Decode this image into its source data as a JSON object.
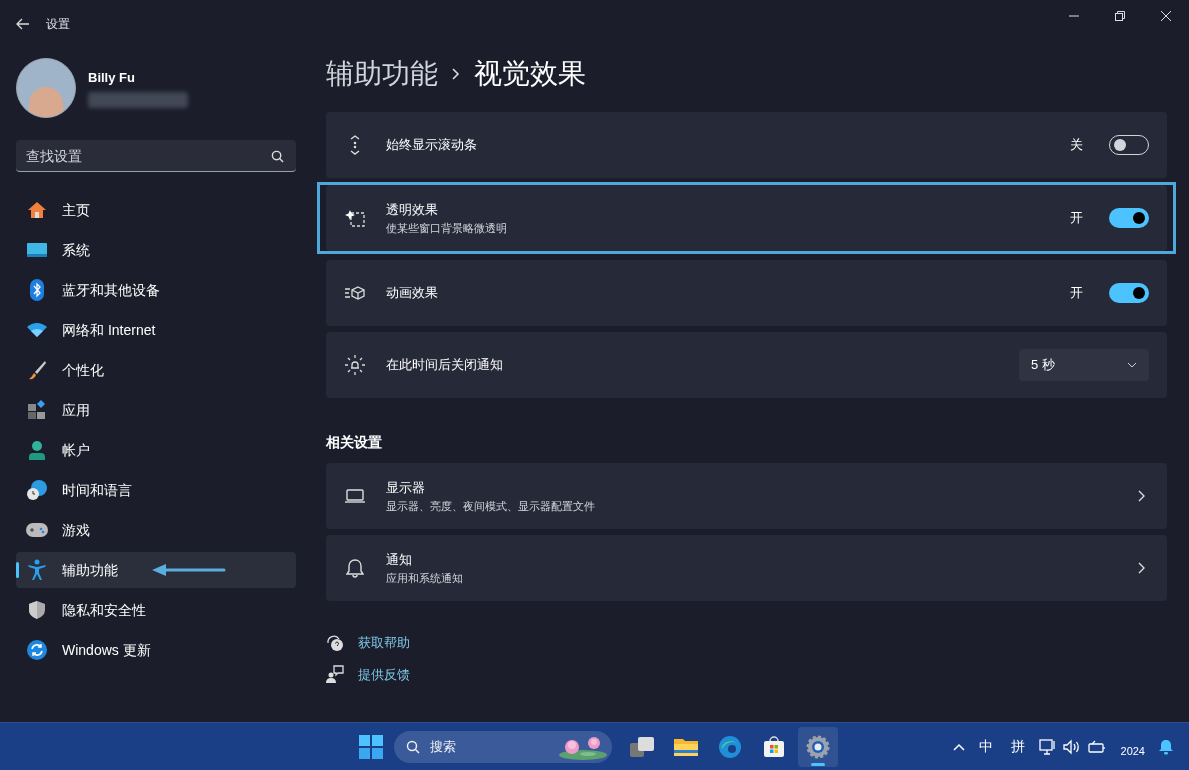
{
  "window": {
    "title": "设置"
  },
  "user": {
    "name": "Billy Fu"
  },
  "search": {
    "placeholder": "查找设置"
  },
  "sidebar": {
    "items": [
      {
        "label": "主页",
        "selected": false,
        "pointer_arrow": false
      },
      {
        "label": "系统",
        "selected": false,
        "pointer_arrow": false
      },
      {
        "label": "蓝牙和其他设备",
        "selected": false,
        "pointer_arrow": false
      },
      {
        "label": "网络和 Internet",
        "selected": false,
        "pointer_arrow": false
      },
      {
        "label": "个性化",
        "selected": false,
        "pointer_arrow": false
      },
      {
        "label": "应用",
        "selected": false,
        "pointer_arrow": false
      },
      {
        "label": "帐户",
        "selected": false,
        "pointer_arrow": false
      },
      {
        "label": "时间和语言",
        "selected": false,
        "pointer_arrow": false
      },
      {
        "label": "游戏",
        "selected": false,
        "pointer_arrow": false
      },
      {
        "label": "辅助功能",
        "selected": true,
        "pointer_arrow": true
      },
      {
        "label": "隐私和安全性",
        "selected": false,
        "pointer_arrow": false
      },
      {
        "label": "Windows 更新",
        "selected": false,
        "pointer_arrow": false
      }
    ]
  },
  "breadcrumb": [
    "辅助功能",
    "视觉效果"
  ],
  "settings": [
    {
      "kind": "toggle",
      "label": "始终显示滚动条",
      "state_text": "关",
      "on": false,
      "highlighted": false
    },
    {
      "kind": "toggle",
      "label": "透明效果",
      "description": "使某些窗口背景略微透明",
      "state_text": "开",
      "on": true,
      "highlighted": true
    },
    {
      "kind": "toggle",
      "label": "动画效果",
      "state_text": "开",
      "on": true,
      "highlighted": false
    },
    {
      "kind": "dropdown",
      "label": "在此时间后关闭通知",
      "value": "5 秒",
      "highlighted": false
    }
  ],
  "related": {
    "title": "相关设置",
    "items": [
      {
        "label": "显示器",
        "description": "显示器、亮度、夜间模式、显示器配置文件"
      },
      {
        "label": "通知",
        "description": "应用和系统通知"
      }
    ]
  },
  "help_links": [
    {
      "label": "获取帮助"
    },
    {
      "label": "提供反馈"
    }
  ],
  "taskbar": {
    "search_placeholder": "搜索",
    "apps": [
      {
        "selected": false
      },
      {
        "selected": false
      },
      {
        "selected": false
      },
      {
        "selected": false
      },
      {
        "selected": true
      }
    ],
    "input_indicators": [
      "中",
      "拼"
    ],
    "clock": "2024"
  }
}
